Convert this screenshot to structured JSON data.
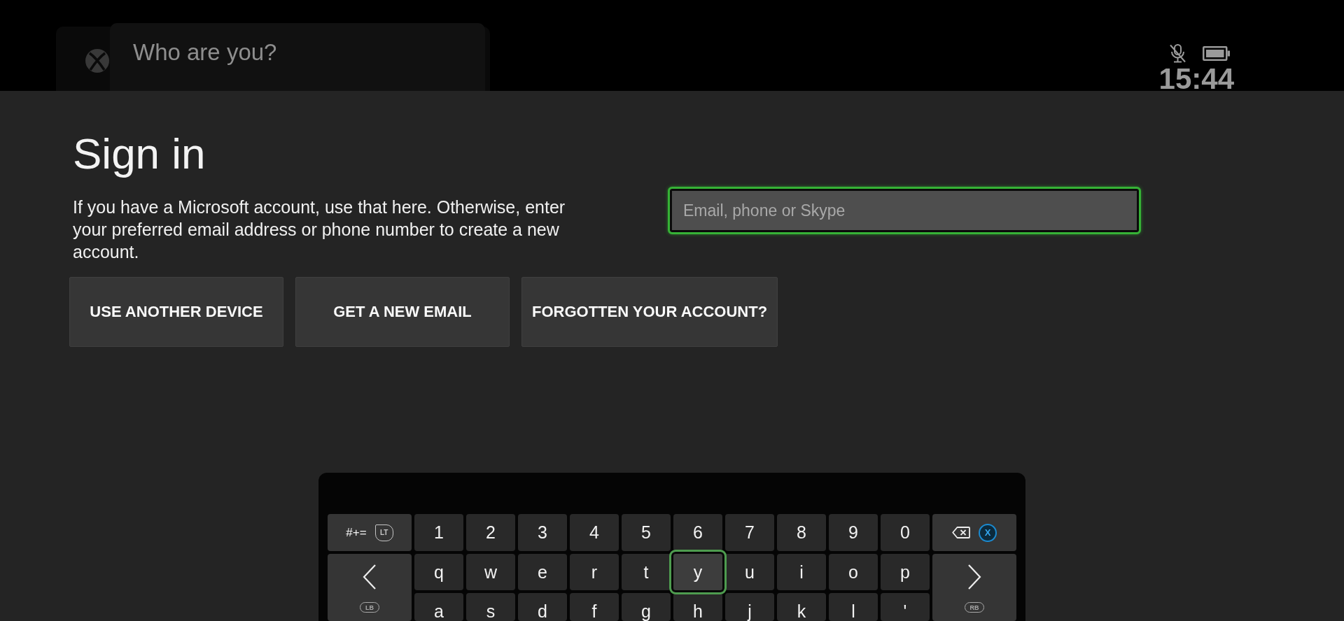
{
  "header": {
    "prompt": "Who are you?",
    "time": "15:44"
  },
  "sign_in": {
    "title": "Sign in",
    "description": "If you have a Microsoft account, use that here. Otherwise, enter your preferred email address or phone number to create a new account.",
    "email_field": {
      "placeholder": "Email, phone or Skype",
      "focused": true
    },
    "buttons": [
      "USE ANOTHER DEVICE",
      "GET A NEW EMAIL",
      "FORGOTTEN YOUR ACCOUNT?"
    ]
  },
  "keyboard": {
    "rows": [
      {
        "keys": [
          {
            "kind": "symbols",
            "label": "#+=",
            "hint": {
              "kind": "trigger",
              "label": "LT"
            },
            "selected": false
          },
          {
            "kind": "char",
            "label": "1",
            "selected": false
          },
          {
            "kind": "char",
            "label": "2",
            "selected": false
          },
          {
            "kind": "char",
            "label": "3",
            "selected": false
          },
          {
            "kind": "char",
            "label": "4",
            "selected": false
          },
          {
            "kind": "char",
            "label": "5",
            "selected": false
          },
          {
            "kind": "char",
            "label": "6",
            "selected": false
          },
          {
            "kind": "char",
            "label": "7",
            "selected": false
          },
          {
            "kind": "char",
            "label": "8",
            "selected": false
          },
          {
            "kind": "char",
            "label": "9",
            "selected": false
          },
          {
            "kind": "char",
            "label": "0",
            "selected": false
          },
          {
            "kind": "backspace",
            "hint": {
              "kind": "face",
              "label": "X"
            },
            "selected": false
          }
        ]
      },
      {
        "keys": [
          {
            "kind": "previous",
            "hint": {
              "kind": "bumper",
              "label": "LB"
            },
            "selected": false
          },
          {
            "kind": "char",
            "label": "q",
            "selected": false
          },
          {
            "kind": "char",
            "label": "w",
            "selected": false
          },
          {
            "kind": "char",
            "label": "e",
            "selected": false
          },
          {
            "kind": "char",
            "label": "r",
            "selected": false
          },
          {
            "kind": "char",
            "label": "t",
            "selected": false
          },
          {
            "kind": "char",
            "label": "y",
            "selected": true
          },
          {
            "kind": "char",
            "label": "u",
            "selected": false
          },
          {
            "kind": "char",
            "label": "i",
            "selected": false
          },
          {
            "kind": "char",
            "label": "o",
            "selected": false
          },
          {
            "kind": "char",
            "label": "p",
            "selected": false
          },
          {
            "kind": "next",
            "hint": {
              "kind": "bumper",
              "label": "RB"
            },
            "selected": false
          }
        ]
      },
      {
        "keys": [
          {
            "kind": "char",
            "label": "a",
            "selected": false
          },
          {
            "kind": "char",
            "label": "s",
            "selected": false
          },
          {
            "kind": "char",
            "label": "d",
            "selected": false
          },
          {
            "kind": "char",
            "label": "f",
            "selected": false
          },
          {
            "kind": "char",
            "label": "g",
            "selected": false
          },
          {
            "kind": "char",
            "label": "h",
            "selected": false
          },
          {
            "kind": "char",
            "label": "j",
            "selected": false
          },
          {
            "kind": "char",
            "label": "k",
            "selected": false
          },
          {
            "kind": "char",
            "label": "l",
            "selected": false
          },
          {
            "kind": "char",
            "label": "'",
            "selected": false
          }
        ]
      }
    ]
  }
}
